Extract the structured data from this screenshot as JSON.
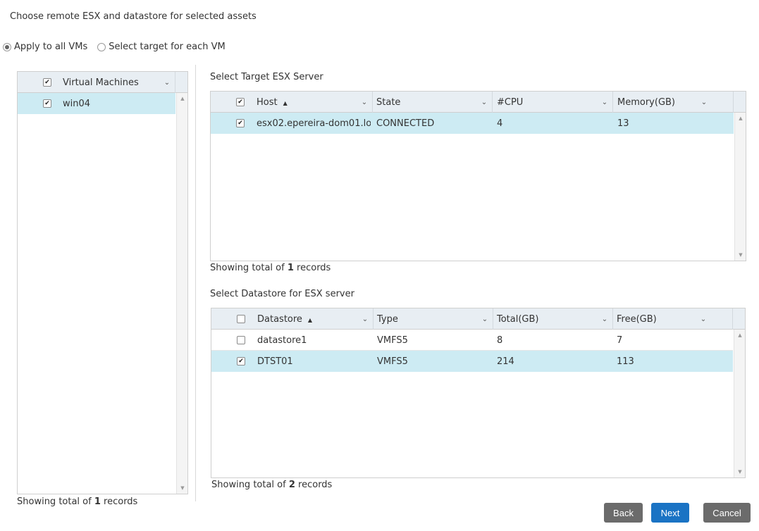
{
  "title": "Choose remote ESX and datastore for selected assets",
  "apply_mode": {
    "options": [
      {
        "label": "Apply to all VMs",
        "selected": true
      },
      {
        "label": "Select target for each VM",
        "selected": false
      }
    ]
  },
  "vm_grid": {
    "header": {
      "label": "Virtual Machines",
      "checked": true
    },
    "rows": [
      {
        "name": "win04",
        "checked": true,
        "selected": true
      }
    ],
    "records_prefix": "Showing total of",
    "records_count": "1",
    "records_suffix": "records"
  },
  "esx_grid": {
    "title": "Select Target ESX Server",
    "columns": [
      "Host",
      "State",
      "#CPU",
      "Memory(GB)"
    ],
    "header_checked": true,
    "rows": [
      {
        "checked": true,
        "selected": true,
        "cells": [
          "esx02.epereira-dom01.lo...",
          "CONNECTED",
          "4",
          "13"
        ]
      }
    ],
    "records_prefix": "Showing total of",
    "records_count": "1",
    "records_suffix": "records"
  },
  "ds_grid": {
    "title": "Select Datastore for ESX server",
    "columns": [
      "Datastore",
      "Type",
      "Total(GB)",
      "Free(GB)"
    ],
    "header_checked": false,
    "rows": [
      {
        "checked": false,
        "selected": false,
        "cells": [
          "datastore1",
          "VMFS5",
          "8",
          "7"
        ]
      },
      {
        "checked": true,
        "selected": true,
        "cells": [
          "DTST01",
          "VMFS5",
          "214",
          "113"
        ]
      }
    ],
    "records_prefix": "Showing total of",
    "records_count": "2",
    "records_suffix": "records"
  },
  "buttons": {
    "back": "Back",
    "next": "Next",
    "cancel": "Cancel"
  },
  "colors": {
    "selected_row": "#cdebf3",
    "header_bg": "#e8eef3",
    "primary_button": "#1a73c4",
    "secondary_button": "#6b6b6b"
  },
  "icons": {
    "sort": "sort-ascending-icon",
    "column_menu": "chevron-down-icon",
    "check": "checkmark-icon"
  }
}
